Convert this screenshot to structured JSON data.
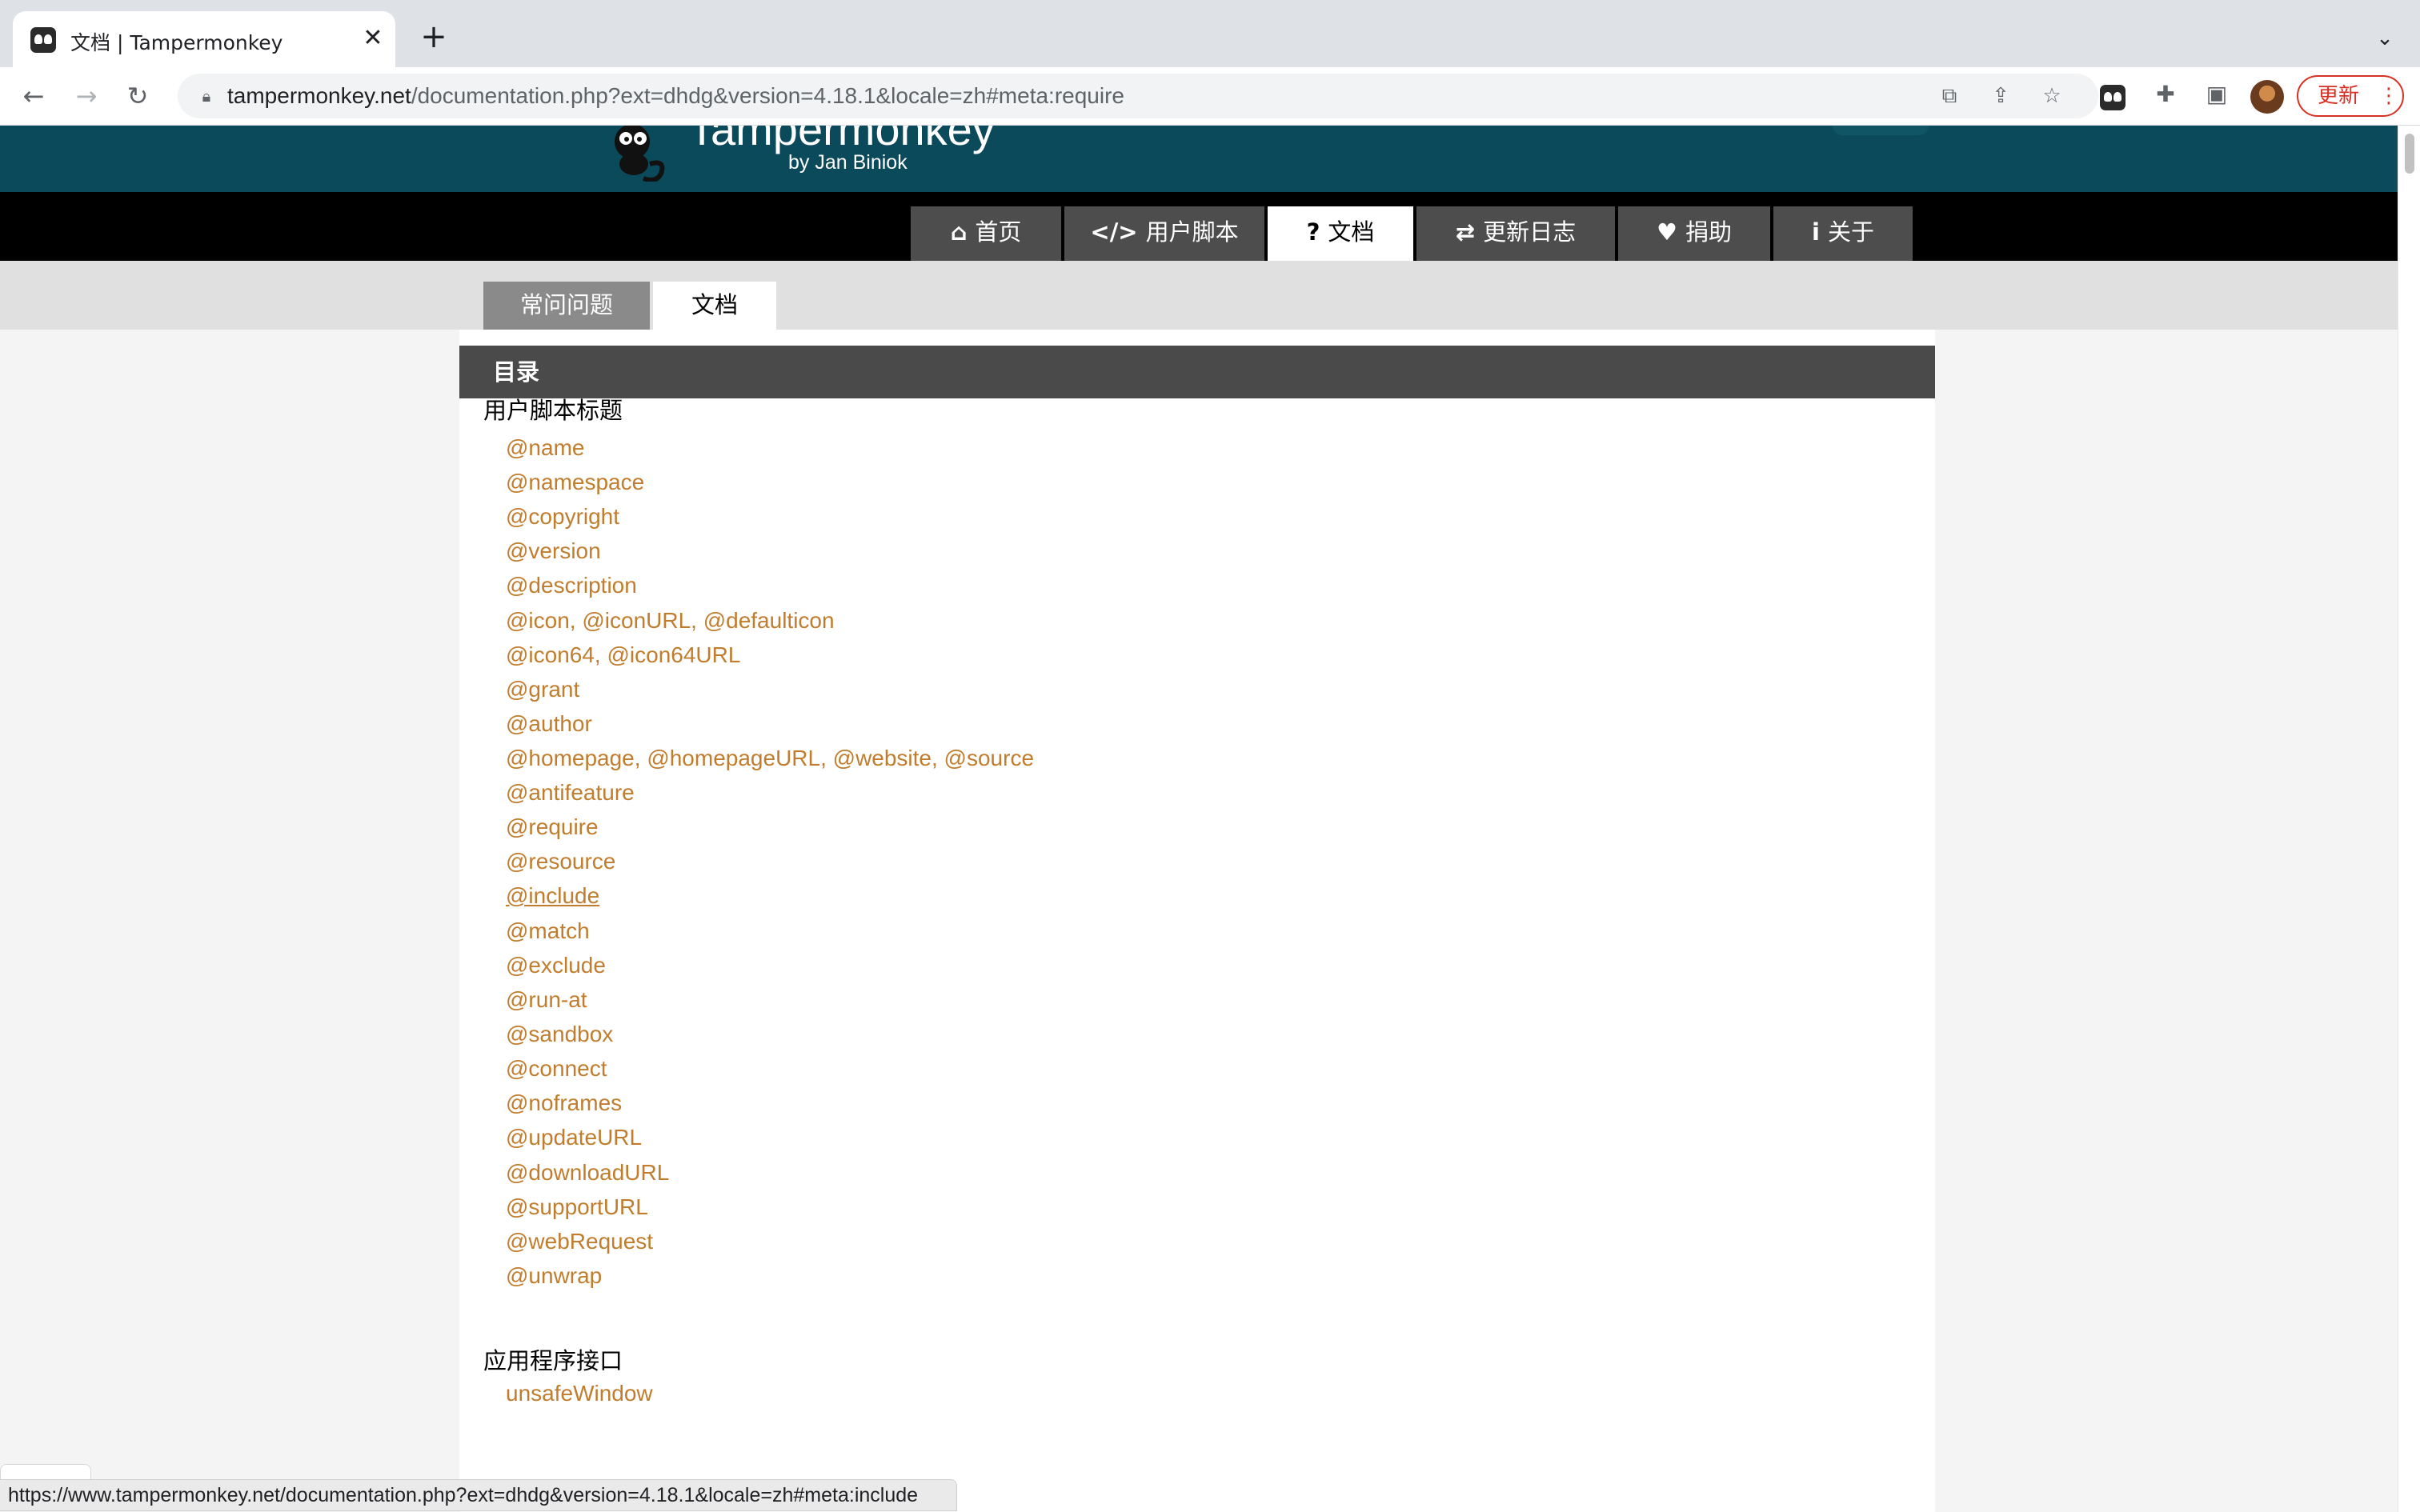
{
  "browser": {
    "tab_title": "文档 | Tampermonkey",
    "tab_close_glyph": "✕",
    "new_tab_glyph": "+",
    "tab_list_glyph": "⌄",
    "url_host": "tampermonkey.net",
    "url_path": "/documentation.php?ext=dhdg&version=4.18.1&locale=zh#meta:require",
    "update_label": "更新",
    "update_menu_glyph": "⋮",
    "status_url": "https://www.tampermonkey.net/documentation.php?ext=dhdg&version=4.18.1&locale=zh#meta:include"
  },
  "site": {
    "logo_title": "Tampermonkey",
    "logo_byline": "by Jan Biniok",
    "nav": [
      {
        "icon": "⌂",
        "label": "首页"
      },
      {
        "icon": "</>",
        "label": "用户脚本"
      },
      {
        "icon": "?",
        "label": "文档"
      },
      {
        "icon": "⇄",
        "label": "更新日志"
      },
      {
        "icon": "♥",
        "label": "捐助"
      },
      {
        "icon": "i",
        "label": "关于"
      }
    ],
    "active_nav_index": 2,
    "subtabs": [
      "常问问题",
      "文档"
    ],
    "active_subtab_index": 1
  },
  "toc": {
    "heading": "目录",
    "sections": [
      {
        "title": "用户脚本标题",
        "links": [
          "@name",
          "@namespace",
          "@copyright",
          "@version",
          "@description",
          "@icon, @iconURL, @defaulticon",
          "@icon64, @icon64URL",
          "@grant",
          "@author",
          "@homepage, @homepageURL, @website, @source",
          "@antifeature",
          "@require",
          "@resource",
          "@include",
          "@match",
          "@exclude",
          "@run-at",
          "@sandbox",
          "@connect",
          "@noframes",
          "@updateURL",
          "@downloadURL",
          "@supportURL",
          "@webRequest",
          "@unwrap"
        ],
        "hovered_link_index": 13
      },
      {
        "title": "应用程序接口",
        "links": [
          "unsafeWindow"
        ]
      }
    ]
  },
  "colors": {
    "header_teal": "#0b4a5a",
    "nav_black": "#000000",
    "nav_item_gray": "#4d4d4d",
    "toc_header": "#4a4a4a",
    "link_orange": "#c17d2d",
    "update_red": "#d93025"
  }
}
